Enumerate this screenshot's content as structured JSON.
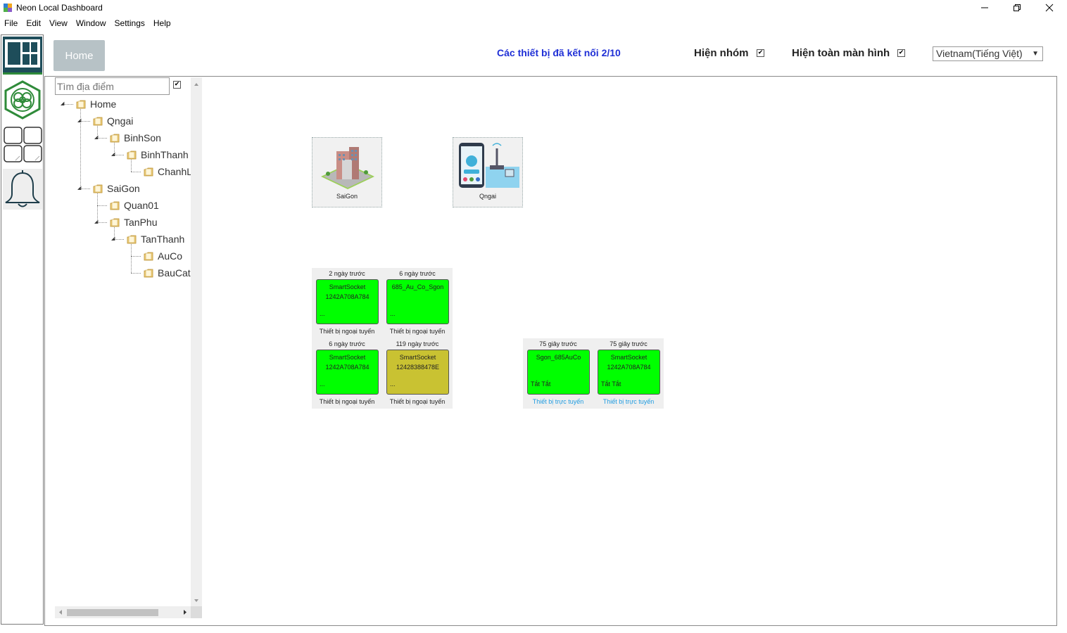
{
  "window": {
    "title": "Neon Local Dashboard"
  },
  "menu": [
    "File",
    "Edit",
    "View",
    "Window",
    "Settings",
    "Help"
  ],
  "header": {
    "home_label": "Home",
    "connected_text": "Các thiết bị đã kết nối 2/10",
    "show_group_label": "Hiện nhóm",
    "show_group_checked": true,
    "fullscreen_label": "Hiện toàn màn hình",
    "fullscreen_checked": true,
    "language": "Vietnam(Tiếng Việt)"
  },
  "tree": {
    "search_placeholder": "Tìm địa điểm",
    "search_checked": true,
    "nodes": [
      {
        "label": "Home",
        "depth": 0
      },
      {
        "label": "Qngai",
        "depth": 1
      },
      {
        "label": "BinhSon",
        "depth": 2
      },
      {
        "label": "BinhThanh",
        "depth": 3
      },
      {
        "label": "ChanhLo",
        "depth": 4
      },
      {
        "label": "SaiGon",
        "depth": 1
      },
      {
        "label": "Quan01",
        "depth": 2
      },
      {
        "label": "TanPhu",
        "depth": 2
      },
      {
        "label": "TanThanh",
        "depth": 3
      },
      {
        "label": "AuCo",
        "depth": 4
      },
      {
        "label": "BauCat",
        "depth": 4
      }
    ]
  },
  "groups": [
    {
      "name": "SaiGon"
    },
    {
      "name": "Qngai"
    }
  ],
  "devices": [
    {
      "time": "2 ngày trước",
      "line1": "SmartSocket",
      "line2": "1242A708A784",
      "state": "...",
      "status": "Thiết bị ngoại tuyến",
      "color": "#00ff00",
      "online": false
    },
    {
      "time": "6 ngày trước",
      "line1": "685_Au_Co_Sgon",
      "line2": "",
      "state": "...",
      "status": "Thiết bị ngoại tuyến",
      "color": "#00ff00",
      "online": false
    },
    {
      "time": "6 ngày trước",
      "line1": "SmartSocket",
      "line2": "1242A708A784",
      "state": "...",
      "status": "Thiết bị ngoại tuyến",
      "color": "#00ff00",
      "online": false
    },
    {
      "time": "119 ngày trước",
      "line1": "SmartSocket",
      "line2": "12428388478E",
      "state": "...",
      "status": "Thiết bị ngoại tuyến",
      "color": "#c9c232",
      "online": false
    },
    {
      "time": "75 giây trước",
      "line1": "Sgon_685AuCo",
      "line2": "",
      "state": "Tắt Tắt",
      "status": "Thiết bị trực tuyến",
      "color": "#00ff00",
      "online": true
    },
    {
      "time": "75 giây trước",
      "line1": "SmartSocket",
      "line2": "1242A708A784",
      "state": "Tắt Tắt",
      "status": "Thiết bị trực tuyến",
      "color": "#00ff00",
      "online": true
    }
  ],
  "colors": {
    "online_text": "#1e9be0",
    "offline_text": "#222222",
    "connected_text": "#1f2fd6"
  }
}
